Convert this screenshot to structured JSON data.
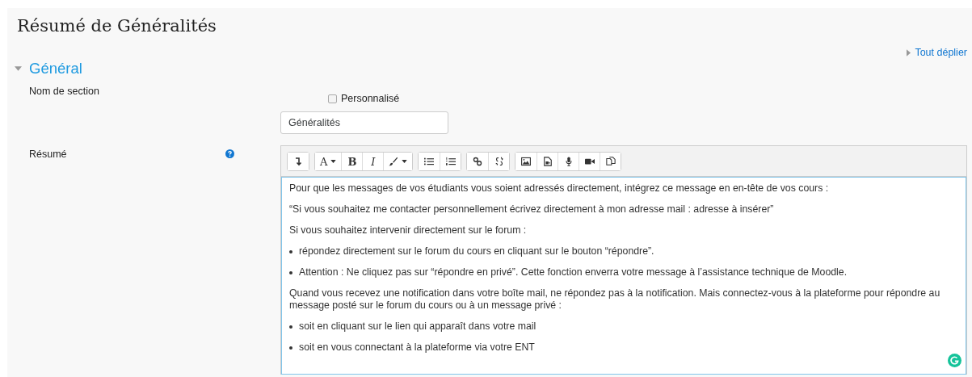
{
  "page": {
    "title": "Résumé de Généralités"
  },
  "expand_all": {
    "label": "Tout déplier"
  },
  "section": {
    "title": "Général",
    "expanded": true
  },
  "section_name": {
    "label": "Nom de section",
    "custom": {
      "label": "Personnalisé",
      "checked": false
    },
    "value": "Généralités"
  },
  "summary": {
    "label": "Résumé",
    "help": true
  },
  "toolbar": [
    [
      {
        "kind": "collapse"
      }
    ],
    [
      {
        "kind": "font",
        "label": "A",
        "dropdown": true
      },
      {
        "kind": "bold",
        "label": "B"
      },
      {
        "kind": "italic",
        "label": "I"
      },
      {
        "kind": "color",
        "dropdown": true
      }
    ],
    [
      {
        "kind": "bullets"
      },
      {
        "kind": "numbers"
      }
    ],
    [
      {
        "kind": "link"
      },
      {
        "kind": "unlink"
      }
    ],
    [
      {
        "kind": "image"
      },
      {
        "kind": "media"
      },
      {
        "kind": "audio"
      },
      {
        "kind": "video"
      },
      {
        "kind": "files"
      }
    ]
  ],
  "content": [
    {
      "kind": "paragraph",
      "text": "Pour que les messages de vos étudiants vous soient adressés directement, intégrez ce message en en-tête de vos cours :"
    },
    {
      "kind": "paragraph",
      "text": "“Si vous souhaitez me contacter personnellement écrivez directement à mon adresse mail : adresse à insérer”"
    },
    {
      "kind": "paragraph",
      "text": "Si vous souhaitez intervenir directement sur le forum :"
    },
    {
      "kind": "bullet",
      "text": "répondez directement sur le forum du cours en cliquant sur le bouton “répondre”."
    },
    {
      "kind": "bullet",
      "text": "Attention : Ne cliquez pas sur “répondre en privé”. Cette fonction enverra votre message à l’assistance technique de Moodle."
    },
    {
      "kind": "paragraph",
      "text": "Quand vous recevez une notification dans votre boîte mail, ne répondez pas à la notification. Mais connectez-vous à la plateforme pour répondre au message posté sur le forum du cours ou à un message privé :"
    },
    {
      "kind": "bullet",
      "text": "soit en cliquant sur le lien qui apparaît dans votre mail"
    },
    {
      "kind": "bullet",
      "text": "soit en vous connectant à la plateforme via votre ENT"
    }
  ]
}
